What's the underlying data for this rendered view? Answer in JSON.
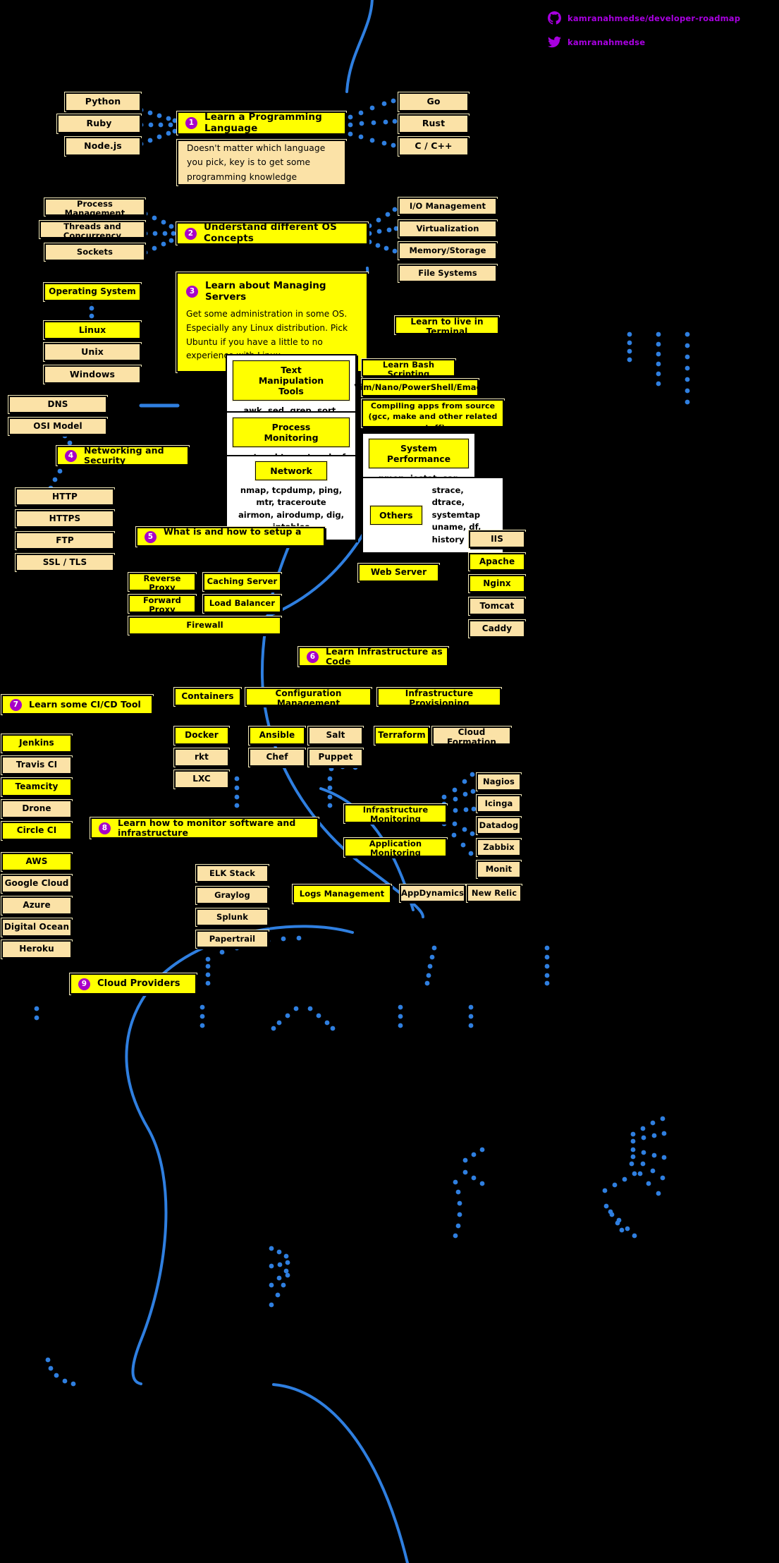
{
  "header": {
    "github_icon": "github-icon",
    "github_handle": "kamranahmedse/developer-roadmap",
    "twitter_icon": "twitter-icon",
    "twitter_handle": "kamranahmedse"
  },
  "accent": {
    "badge": "#a800c8",
    "node_yellow": "#ffff00",
    "node_tan": "#fbe2a7",
    "edge_blue": "#2f7fe0",
    "background": "#000000",
    "link_purple": "#a800e0"
  },
  "steps": [
    {
      "number": "1",
      "title": "Learn a Programming Language",
      "description": "Doesn't matter which language you pick, key is to get some programming knowledge",
      "left_items": [
        "Python",
        "Ruby",
        "Node.js"
      ],
      "right_items": [
        "Go",
        "Rust",
        "C / C++"
      ]
    },
    {
      "number": "2",
      "title": "Understand different OS Concepts",
      "left_items": [
        "Process Management",
        "Threads and Concurrency",
        "Sockets"
      ],
      "right_items": [
        "I/O Management",
        "Virtualization",
        "Memory/Storage",
        "File Systems"
      ]
    },
    {
      "number": "3",
      "title": "Learn about Managing Servers",
      "description": "Get some administration in some OS. Especially any Linux distribution. Pick Ubuntu if you have a little to no experience with Linux."
    },
    {
      "number": "4",
      "title": "Networking and Security"
    },
    {
      "number": "5",
      "title": "What is and how to setup a ___________"
    },
    {
      "number": "6",
      "title": "Learn Infrastructure as Code"
    },
    {
      "number": "7",
      "title": "Learn some CI/CD Tool"
    },
    {
      "number": "8",
      "title": "Learn how to monitor software and infrastructure"
    },
    {
      "number": "9",
      "title": "Cloud Providers"
    }
  ],
  "os": {
    "heading": "Operating System",
    "items": [
      "Linux",
      "Unix",
      "Windows"
    ]
  },
  "terminal": {
    "heading": "Learn to live in Terminal",
    "simple_items": [
      "Learn Bash Scripting",
      "Vim/Nano/PowerShell/Emacs",
      "Compiling apps from source\n(gcc, make and other related stuff)"
    ],
    "groups": [
      {
        "header": "Text Manipulation Tools",
        "commands": "awk, sed, grep, sort, uniq, cat, cut\necho, fmt, tr, nl, egrep, fgrep, wc"
      },
      {
        "header": "Process Monitoring",
        "commands": "ps, top, htop, atop, lsof"
      },
      {
        "header": "Network",
        "commands": "nmap, tcpdump, ping, mtr, traceroute\nairmon, airodump, dig, iptables"
      },
      {
        "header": "System Performance",
        "commands": "nmon, iostat, sar, vmstat"
      },
      {
        "header": "Others",
        "commands": "strace, dtrace, systemtap\nuname, df, history"
      }
    ]
  },
  "networking": {
    "above_items": [
      "DNS",
      "OSI Model"
    ],
    "below_items": [
      "HTTP",
      "HTTPS",
      "FTP",
      "SSL / TLS"
    ]
  },
  "setup": {
    "col_left": [
      "Reverse Proxy",
      "Forward Proxy"
    ],
    "col_right": [
      "Caching Server",
      "Load Balancer"
    ],
    "wide": "Firewall",
    "web_server": "Web Server",
    "web_server_items": [
      "IIS",
      "Apache",
      "Nginx",
      "Tomcat",
      "Caddy"
    ]
  },
  "iac": {
    "categories": [
      "Containers",
      "Configuration Management",
      "Infrastructure Provisioning"
    ],
    "containers": [
      "Docker",
      "rkt",
      "LXC"
    ],
    "config_management_col1": [
      "Ansible",
      "Chef"
    ],
    "config_management_col2": [
      "Salt",
      "Puppet"
    ],
    "provisioning": [
      "Terraform",
      "Cloud Formation"
    ]
  },
  "cicd": {
    "items": [
      "Jenkins",
      "Travis CI",
      "Teamcity",
      "Drone",
      "Circle CI"
    ]
  },
  "cloud": {
    "items": [
      "AWS",
      "Google Cloud",
      "Azure",
      "Digital Ocean",
      "Heroku"
    ]
  },
  "monitoring": {
    "infrastructure_label": "Infrastructure Monitoring",
    "application_label": "Application Monitoring",
    "logs_label": "Logs Management",
    "infra_tools": [
      "Nagios",
      "Icinga",
      "Datadog",
      "Zabbix",
      "Monit"
    ],
    "app_tools": [
      "AppDynamics",
      "New Relic"
    ],
    "log_tools": [
      "ELK Stack",
      "Graylog",
      "Splunk",
      "Papertrail"
    ]
  }
}
